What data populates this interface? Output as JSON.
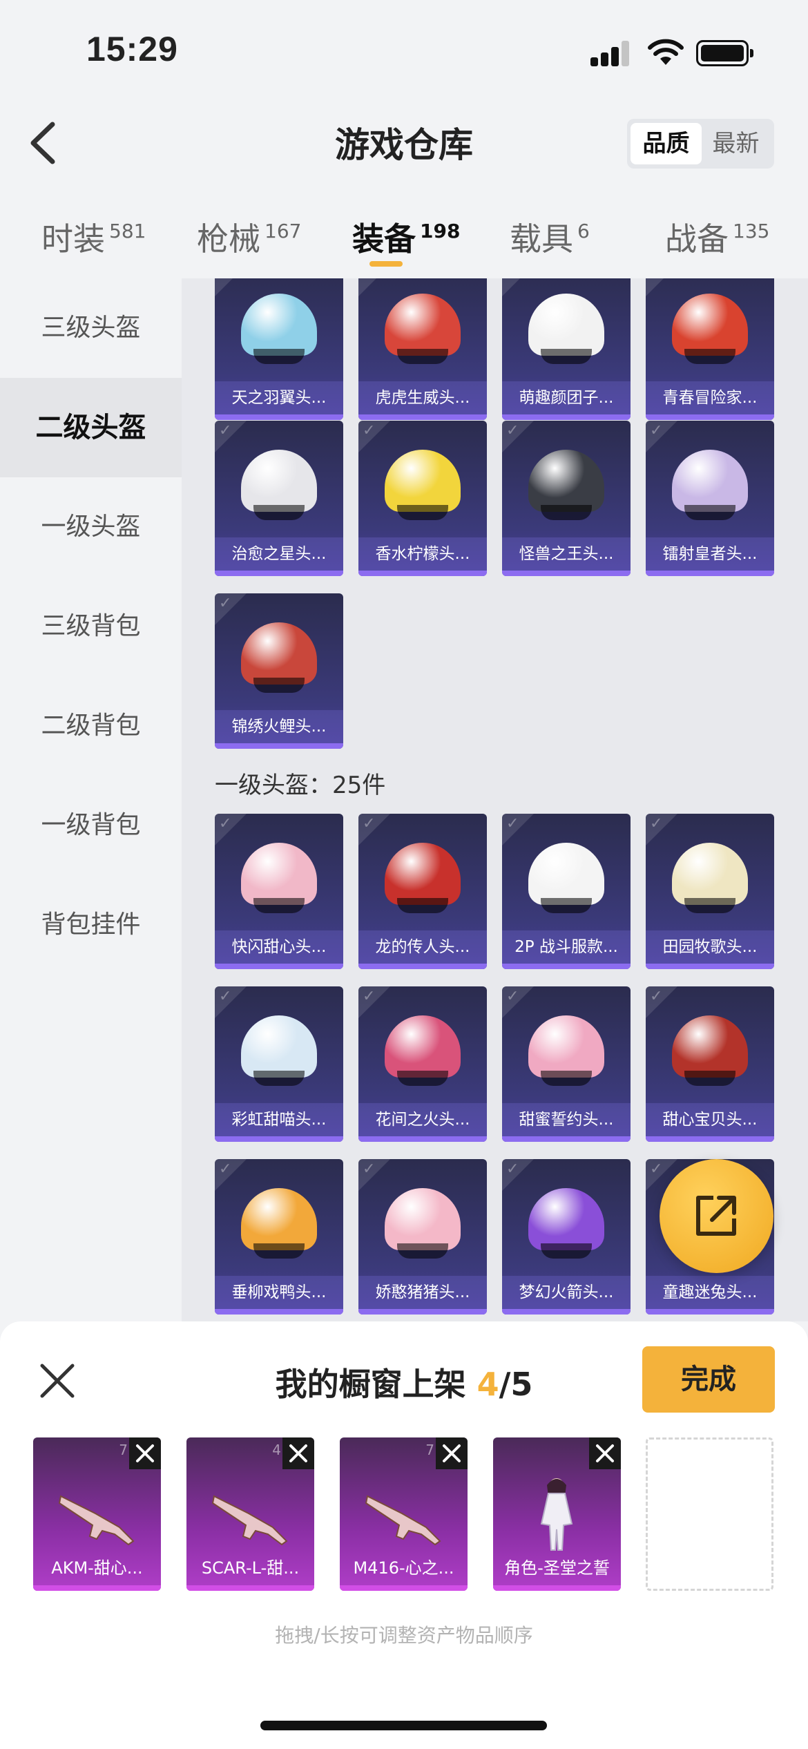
{
  "status_bar": {
    "time": "15:29"
  },
  "header": {
    "title": "游戏仓库",
    "sort_quality": "品质",
    "sort_newest": "最新"
  },
  "tabs": [
    {
      "label": "时装",
      "count": "581"
    },
    {
      "label": "枪械",
      "count": "167"
    },
    {
      "label": "装备",
      "count": "198"
    },
    {
      "label": "载具",
      "count": "6"
    },
    {
      "label": "战备",
      "count": "135"
    }
  ],
  "sidebar": {
    "items": [
      "三级头盔",
      "二级头盔",
      "一级头盔",
      "三级背包",
      "二级背包",
      "一级背包",
      "背包挂件"
    ]
  },
  "level2_helmets": [
    {
      "name": "天之羽翼头...",
      "color": "#8fd0e8"
    },
    {
      "name": "虎虎生威头...",
      "color": "#d8463a"
    },
    {
      "name": "萌趣颜团子...",
      "color": "#f2f2f2"
    },
    {
      "name": "青春冒险家...",
      "color": "#d9432f"
    },
    {
      "name": "治愈之星头...",
      "color": "#e6e6ea"
    },
    {
      "name": "香水柠檬头...",
      "color": "#f2d53c"
    },
    {
      "name": "怪兽之王头...",
      "color": "#3a3d45"
    },
    {
      "name": "镭射皇者头...",
      "color": "#c9b8e6"
    },
    {
      "name": "锦绣火鲤头...",
      "color": "#c9473b"
    }
  ],
  "level1_section": {
    "title": "一级头盔：25件"
  },
  "level1_helmets": [
    {
      "name": "快闪甜心头...",
      "color": "#f1b8c8"
    },
    {
      "name": "龙的传人头...",
      "color": "#c8312c"
    },
    {
      "name": "2P 战斗服款...",
      "color": "#f4f4f4"
    },
    {
      "name": "田园牧歌头...",
      "color": "#efe6c2"
    },
    {
      "name": "彩虹甜喵头...",
      "color": "#d8e8f4"
    },
    {
      "name": "花间之火头...",
      "color": "#d9537a"
    },
    {
      "name": "甜蜜誓约头...",
      "color": "#f0a9c2"
    },
    {
      "name": "甜心宝贝头...",
      "color": "#b3332a"
    },
    {
      "name": "垂柳戏鸭头...",
      "color": "#f2a83a"
    },
    {
      "name": "娇憨猪猪头...",
      "color": "#f4b8c8"
    },
    {
      "name": "梦幻火箭头...",
      "color": "#8a4fd8"
    },
    {
      "name": "童趣迷兔头...",
      "color": "#eeeeee"
    }
  ],
  "showcase": {
    "title": "我的橱窗上架",
    "current": "4",
    "total": "/5",
    "done_label": "完成",
    "hint": "拖拽/长按可调整资产物品顺序",
    "items": [
      {
        "name": "AKM-甜心...",
        "tag": "7",
        "icon": "rifle-icon"
      },
      {
        "name": "SCAR-L-甜...",
        "tag": "4",
        "icon": "rifle-icon"
      },
      {
        "name": "M416-心之...",
        "tag": "7",
        "icon": "rifle-icon"
      },
      {
        "name": "角色-圣堂之誓",
        "tag": "",
        "icon": "character-icon"
      }
    ]
  },
  "colors": {
    "accent": "#f4b23b",
    "card_purple": "#3b3a7a",
    "showcase_magenta": "#b03ec8"
  }
}
